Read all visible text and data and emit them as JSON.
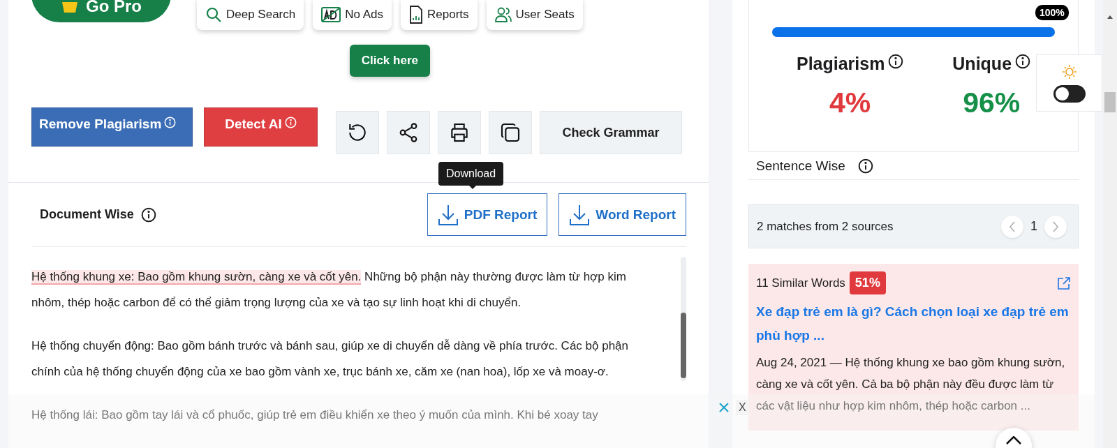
{
  "promo": {
    "go_pro": "Go Pro",
    "features": [
      {
        "kind": "search",
        "label": "Deep Search"
      },
      {
        "kind": "ads",
        "label": "No Ads"
      },
      {
        "kind": "reports",
        "label": "Reports"
      },
      {
        "kind": "users",
        "label": "User Seats"
      }
    ],
    "cta": "Click here"
  },
  "actions": {
    "remove": "Remove Plagiarism",
    "detect": "Detect AI",
    "tools": [
      {
        "kind": "reload"
      },
      {
        "kind": "share"
      },
      {
        "kind": "print"
      },
      {
        "kind": "copy"
      }
    ],
    "check_grammar": "Check Grammar"
  },
  "tooltip": "Download",
  "document": {
    "title": "Document Wise",
    "downloads": [
      "PDF Report",
      "Word Report"
    ],
    "paragraphs": [
      [
        {
          "text": "Hệ thống khung xe: Bao gồm khung sườn, càng xe và cốt yên.",
          "highlighted": true
        },
        {
          "text": " Những bộ phận này thường được làm từ hợp kim nhôm, thép hoặc carbon để có thể giảm trọng lượng của xe và tạo sự linh hoạt khi di chuyển.",
          "highlighted": false
        }
      ],
      [
        {
          "text": "Hệ thống chuyển động: Bao gồm bánh trước và bánh sau, giúp xe di chuyển dễ dàng về phía trước. Các bộ phận chính của hệ thống chuyển động của xe bao gồm vành xe, trục bánh xe, căm xe (nan hoa), lốp xe và moay-ơ.",
          "highlighted": false
        }
      ],
      [
        {
          "text": "Hệ thống lái: Bao gồm tay lái và cổ phuốc, giúp trẻ em điều khiển xe theo ý muốn của mình. Khi bé xoay tay",
          "highlighted": false
        }
      ]
    ]
  },
  "result": {
    "progress": {
      "level": 1,
      "label": "100%"
    },
    "stats": [
      {
        "kind": "plagiarism",
        "label": "Plagiarism",
        "value": "4%"
      },
      {
        "kind": "unique",
        "label": "Unique",
        "value": "96%"
      }
    ]
  },
  "sentence_wise": "Sentence Wise",
  "matches": {
    "summary": "2 matches from 2 sources",
    "page": "1"
  },
  "sources": [
    {
      "similar": "11 Similar Words",
      "percent": "51%",
      "title": "Xe đạp trẻ em là gì? Cách chọn loại xe đạp trẻ em phù hợp ...",
      "snippet": "Aug 24, 2021 — Hệ thống khung xe bao gồm khung sườn, càng xe và cốt yên. Cả ba bộ phận này đều được làm từ các vật liệu như hợp kim nhôm, thép hoặc carbon ..."
    }
  ],
  "theme_toggle": {
    "on": false
  },
  "ad_bar": {
    "close": "X"
  }
}
